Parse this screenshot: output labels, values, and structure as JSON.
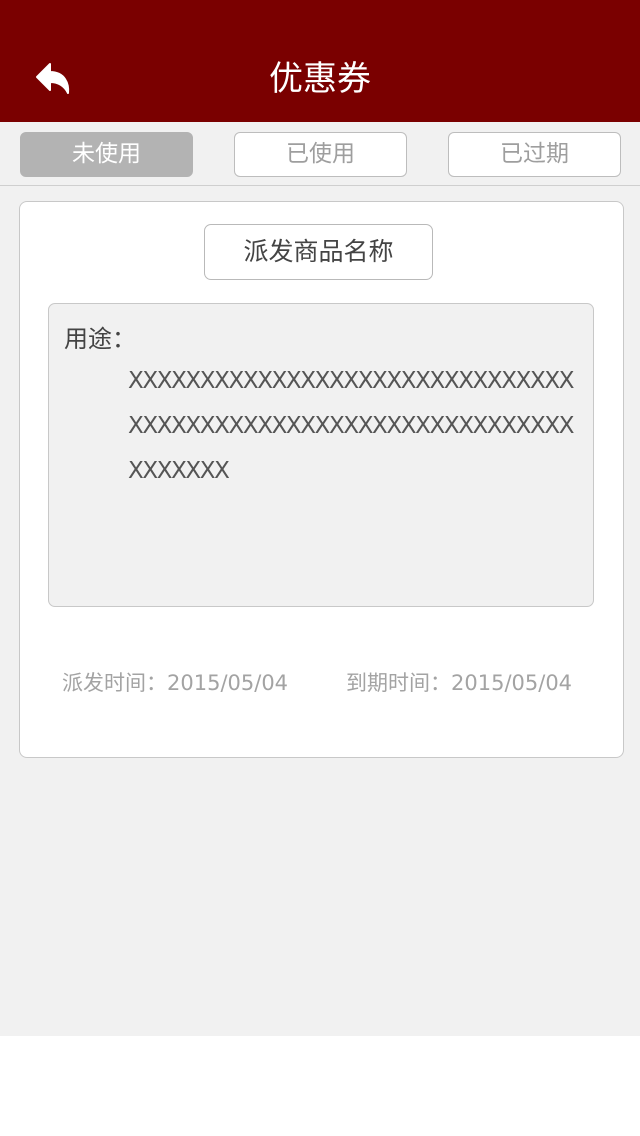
{
  "header": {
    "title": "优惠券",
    "back_icon": "back-arrow-icon",
    "background_color": "#7a0000"
  },
  "tabs": [
    {
      "label": "未使用",
      "active": true
    },
    {
      "label": "已使用",
      "active": false
    },
    {
      "label": "已过期",
      "active": false
    }
  ],
  "coupon": {
    "product_name": "派发商品名称",
    "usage_label": "用途：",
    "usage_text": "XXXXXXXXXXXXXXXXXXXXXXXXXXXXXXXXXXXXXXXXXXXXXXXXXXXXXXXXXXXXXXXXXXXXX",
    "issue_date_label": "派发时间：",
    "issue_date": "2015/05/04",
    "expire_date_label": "到期时间：",
    "expire_date": "2015/05/04"
  }
}
